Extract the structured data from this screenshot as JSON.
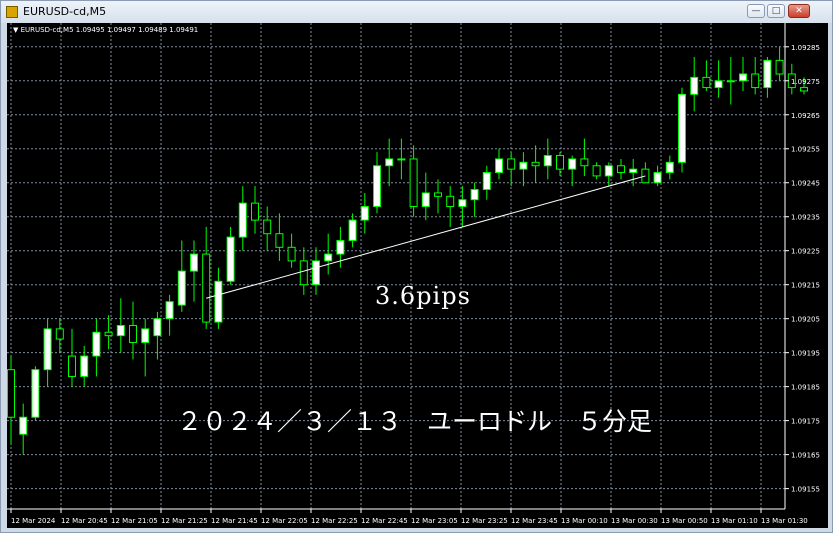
{
  "window": {
    "title": "EURUSD-cd,M5"
  },
  "header": {
    "symbol": "EURUSD-cd,M5",
    "ohlc": "1.09495 1.09497 1.09489 1.09491"
  },
  "annotations": {
    "pips_text": "3.6pips",
    "caption": "２０２４／３／１３　ユーロドル　５分足"
  },
  "colors": {
    "background": "#000000",
    "grid": "#7f8c9b",
    "bull_candle": "#ffffff",
    "bear_candle": "#000000",
    "wick_and_outline": "#00ff00",
    "trendline": "#ffffff",
    "axis_text": "#ffffff"
  },
  "chart_data": {
    "type": "candlestick",
    "y_ticks": [
      "1.09285",
      "1.09275",
      "1.09265",
      "1.09255",
      "1.09245",
      "1.09235",
      "1.09225",
      "1.09215",
      "1.09205",
      "1.09195",
      "1.09185",
      "1.09175",
      "1.09165",
      "1.09155"
    ],
    "x_ticks": [
      "12 Mar 2024",
      "12 Mar 20:45",
      "12 Mar 21:05",
      "12 Mar 21:25",
      "12 Mar 21:45",
      "12 Mar 22:05",
      "12 Mar 22:25",
      "12 Mar 22:45",
      "12 Mar 23:05",
      "12 Mar 23:25",
      "12 Mar 23:45",
      "13 Mar 00:10",
      "13 Mar 00:30",
      "13 Mar 00:50",
      "13 Mar 01:10",
      "13 Mar 01:30"
    ],
    "ylim": [
      1.09149,
      1.09292
    ],
    "grid": true,
    "trendline": {
      "from": {
        "candle": 16,
        "price": 1.09211
      },
      "to": {
        "candle": 52,
        "price": 1.09247
      }
    },
    "candles": [
      [
        1.0919,
        1.09194,
        1.09168,
        1.09176
      ],
      [
        1.09171,
        1.0918,
        1.09165,
        1.09176
      ],
      [
        1.09176,
        1.09191,
        1.09175,
        1.0919
      ],
      [
        1.0919,
        1.09205,
        1.09185,
        1.09202
      ],
      [
        1.09202,
        1.09205,
        1.09195,
        1.09199
      ],
      [
        1.09194,
        1.09202,
        1.09185,
        1.09188
      ],
      [
        1.09188,
        1.09197,
        1.09185,
        1.09194
      ],
      [
        1.09194,
        1.09205,
        1.09188,
        1.09201
      ],
      [
        1.09201,
        1.09206,
        1.09196,
        1.092
      ],
      [
        1.092,
        1.09211,
        1.09195,
        1.09203
      ],
      [
        1.09203,
        1.0921,
        1.09193,
        1.09198
      ],
      [
        1.09198,
        1.09205,
        1.09188,
        1.09202
      ],
      [
        1.092,
        1.09207,
        1.09193,
        1.09205
      ],
      [
        1.09205,
        1.09212,
        1.092,
        1.0921
      ],
      [
        1.09209,
        1.09228,
        1.09207,
        1.09219
      ],
      [
        1.09219,
        1.09228,
        1.0921,
        1.09224
      ],
      [
        1.09224,
        1.09232,
        1.09202,
        1.09204
      ],
      [
        1.09204,
        1.0922,
        1.09202,
        1.09216
      ],
      [
        1.09216,
        1.09232,
        1.09215,
        1.09229
      ],
      [
        1.09229,
        1.09244,
        1.09225,
        1.09239
      ],
      [
        1.09239,
        1.09244,
        1.0923,
        1.09234
      ],
      [
        1.09234,
        1.09238,
        1.09225,
        1.0923
      ],
      [
        1.0923,
        1.09236,
        1.09222,
        1.09226
      ],
      [
        1.09226,
        1.0923,
        1.0922,
        1.09222
      ],
      [
        1.09222,
        1.09226,
        1.09212,
        1.09215
      ],
      [
        1.09215,
        1.09226,
        1.09212,
        1.09222
      ],
      [
        1.09222,
        1.0923,
        1.09218,
        1.09224
      ],
      [
        1.09224,
        1.09232,
        1.0922,
        1.09228
      ],
      [
        1.09228,
        1.09236,
        1.09226,
        1.09234
      ],
      [
        1.09234,
        1.09242,
        1.0923,
        1.09238
      ],
      [
        1.09238,
        1.09254,
        1.09236,
        1.0925
      ],
      [
        1.0925,
        1.09258,
        1.09244,
        1.09252
      ],
      [
        1.09252,
        1.09258,
        1.09246,
        1.09252
      ],
      [
        1.09252,
        1.09256,
        1.09235,
        1.09238
      ],
      [
        1.09238,
        1.09248,
        1.09234,
        1.09242
      ],
      [
        1.09242,
        1.09246,
        1.09236,
        1.09241
      ],
      [
        1.09241,
        1.09244,
        1.09232,
        1.09238
      ],
      [
        1.09238,
        1.09244,
        1.09232,
        1.0924
      ],
      [
        1.0924,
        1.09245,
        1.09235,
        1.09243
      ],
      [
        1.09243,
        1.0925,
        1.0924,
        1.09248
      ],
      [
        1.09248,
        1.09255,
        1.09246,
        1.09252
      ],
      [
        1.09252,
        1.09254,
        1.09244,
        1.09249
      ],
      [
        1.09249,
        1.09254,
        1.09244,
        1.09251
      ],
      [
        1.09251,
        1.09256,
        1.09245,
        1.0925
      ],
      [
        1.0925,
        1.09258,
        1.09246,
        1.09253
      ],
      [
        1.09253,
        1.09254,
        1.09247,
        1.09249
      ],
      [
        1.09249,
        1.09253,
        1.09244,
        1.09252
      ],
      [
        1.09252,
        1.09258,
        1.09247,
        1.0925
      ],
      [
        1.0925,
        1.09251,
        1.09246,
        1.09247
      ],
      [
        1.09247,
        1.09251,
        1.09244,
        1.0925
      ],
      [
        1.0925,
        1.09252,
        1.09246,
        1.09248
      ],
      [
        1.09248,
        1.09252,
        1.09244,
        1.09249
      ],
      [
        1.09249,
        1.09251,
        1.09245,
        1.09245
      ],
      [
        1.09245,
        1.0925,
        1.09244,
        1.09248
      ],
      [
        1.09248,
        1.09253,
        1.09246,
        1.09251
      ],
      [
        1.09251,
        1.09273,
        1.09248,
        1.09271
      ],
      [
        1.09271,
        1.09282,
        1.09266,
        1.09276
      ],
      [
        1.09276,
        1.09281,
        1.09272,
        1.09273
      ],
      [
        1.09273,
        1.09281,
        1.0927,
        1.09275
      ],
      [
        1.09275,
        1.09282,
        1.09268,
        1.09275
      ],
      [
        1.09275,
        1.09282,
        1.09272,
        1.09277
      ],
      [
        1.09277,
        1.09282,
        1.09271,
        1.09273
      ],
      [
        1.09273,
        1.09282,
        1.0927,
        1.09281
      ],
      [
        1.09281,
        1.09285,
        1.09275,
        1.09277
      ],
      [
        1.09277,
        1.0928,
        1.09271,
        1.09273
      ],
      [
        1.09273,
        1.09276,
        1.09271,
        1.09272
      ]
    ]
  }
}
